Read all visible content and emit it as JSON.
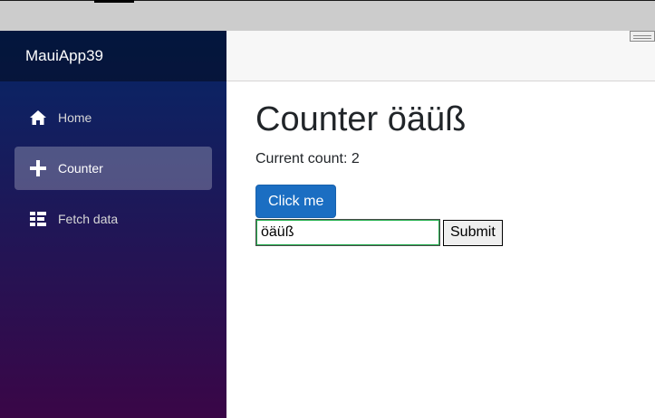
{
  "app": {
    "brand": "MauiApp39"
  },
  "sidebar": {
    "items": [
      {
        "label": "Home",
        "icon": "home-icon",
        "active": false
      },
      {
        "label": "Counter",
        "icon": "plus-icon",
        "active": true
      },
      {
        "label": "Fetch data",
        "icon": "list-icon",
        "active": false
      }
    ]
  },
  "main": {
    "title": "Counter öäüß",
    "count_text": "Current count: 2",
    "click_label": "Click me",
    "input_value": "öäüß",
    "submit_label": "Submit"
  },
  "colors": {
    "sidebar_top": "#052767",
    "sidebar_bottom": "#3a0647",
    "button_primary": "#1b6ec2",
    "input_border": "#26b050"
  }
}
